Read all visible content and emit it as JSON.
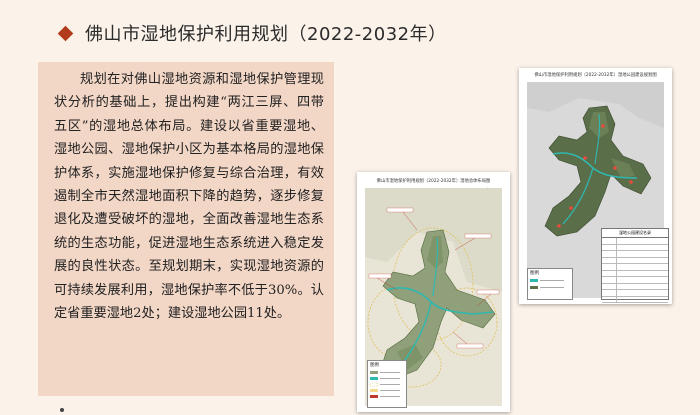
{
  "heading": {
    "text": "佛山市湿地保护利用规划（2022-2032年）",
    "bullet_color": "#b23a1d"
  },
  "body_text": "规划在对佛山湿地资源和湿地保护管理现状分析的基础上，提出构建“两江三屏、四带五区”的湿地总体布局。建设以省重要湿地、湿地公园、湿地保护小区为基本格局的湿地保护体系，实施湿地保护修复与综合治理，有效遏制全市天然湿地面积下降的趋势，逐步修复退化及遭受破坏的湿地，全面改善湿地生态系统的生态功能，促进湿地生态系统进入稳定发展的良性状态。至规划期末，实现湿地资源的可持续发展利用，湿地保护率不低于30%。认定省重要湿地2处；建设湿地公园11处。",
  "map_left": {
    "title": "佛山市湿地保护利用规划（2022-2032年）湿地总体布局图",
    "legend_title": "图例"
  },
  "map_right": {
    "title": "佛山市湿地保护利用规划（2022-2032年）湿地公园建设规划图",
    "legend_title": "图例",
    "table_title": "湿地公园建设名录"
  },
  "colors": {
    "page_bg": "#fbf3ea",
    "panel_bg": "#f2d6c6",
    "land": "#8fa07a",
    "water": "#2fb8b0",
    "ring": "#e0c25a"
  }
}
